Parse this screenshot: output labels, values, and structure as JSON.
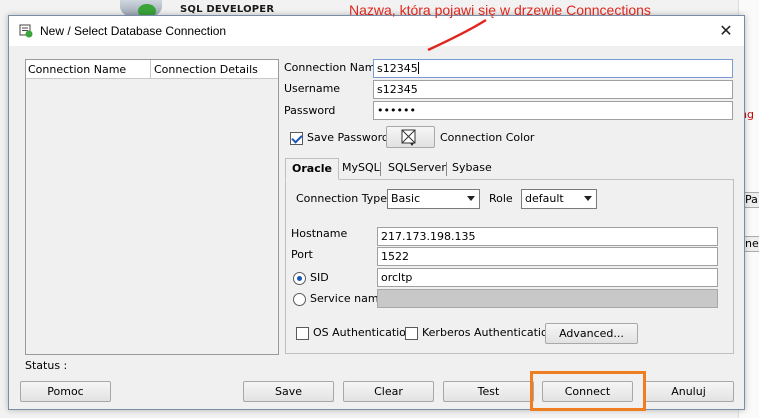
{
  "background": {
    "app_title": "SQL DEVELOPER",
    "right_text_1": "ng",
    "right_text_2": "Pa",
    "right_text_3": "ne"
  },
  "annotation": "Nazwa, która pojawi się w drzewie Conncections",
  "dialog": {
    "title": "New / Select Database Connection",
    "close_glyph": "✕"
  },
  "connection_list": {
    "col_name": "Connection Name",
    "col_details": "Connection Details"
  },
  "status_label": "Status :",
  "form": {
    "connection_name_label": "Connection Name",
    "connection_name_value": "s12345",
    "username_label": "Username",
    "username_value": "s12345",
    "password_label": "Password",
    "password_value": "••••••",
    "save_password_label": "Save Password",
    "save_password_checked": true,
    "connection_color_label": "Connection Color"
  },
  "tabs": [
    {
      "label": "Oracle",
      "active": true
    },
    {
      "label": "MySQL",
      "active": false
    },
    {
      "label": "SQLServer",
      "active": false
    },
    {
      "label": "Sybase",
      "active": false
    }
  ],
  "oracle": {
    "connection_type_label": "Connection Type",
    "connection_type_value": "Basic",
    "role_label": "Role",
    "role_value": "default",
    "hostname_label": "Hostname",
    "hostname_value": "217.173.198.135",
    "port_label": "Port",
    "port_value": "1522",
    "sid_label": "SID",
    "sid_value": "orcltp",
    "service_name_label": "Service name",
    "service_name_value": "",
    "os_auth_label": "OS Authentication",
    "kerberos_label": "Kerberos Authentication",
    "advanced_label": "Advanced..."
  },
  "buttons": {
    "help": "Pomoc",
    "save": "Save",
    "clear": "Clear",
    "test": "Test",
    "connect": "Connect",
    "cancel": "Anuluj"
  },
  "colors": {
    "annotation": "#e0261c",
    "highlight": "#ef7d22"
  }
}
